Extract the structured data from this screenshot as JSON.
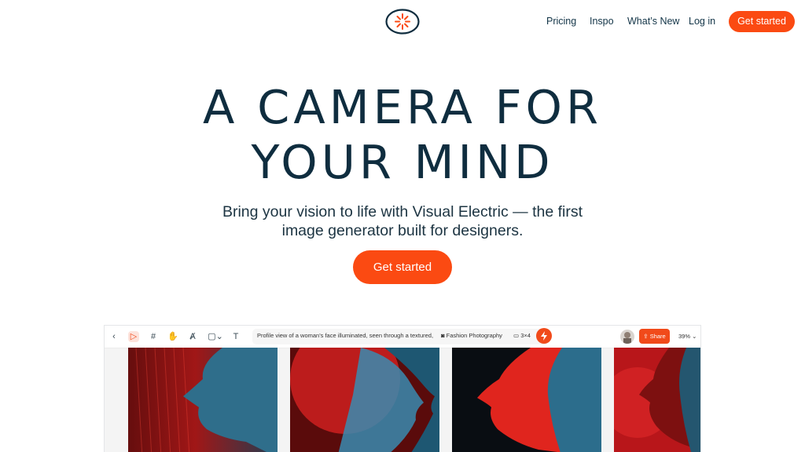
{
  "header": {
    "logo_name": "sunburst-logo",
    "nav": [
      {
        "label": "Pricing"
      },
      {
        "label": "Inspo"
      },
      {
        "label": "What’s New"
      },
      {
        "label": "Log in"
      }
    ],
    "cta_label": "Get started"
  },
  "hero": {
    "title_line1": "A CAMERA FOR",
    "title_line2": "YOUR MIND",
    "subtitle_line1": "Bring your vision to life with Visual Electric — the first",
    "subtitle_line2": "image generator built for designers.",
    "cta_label": "Get started"
  },
  "preview": {
    "toolbar": {
      "tools": [
        "back-icon",
        "select-icon",
        "frame-icon",
        "hand-icon",
        "pen-icon",
        "shape-icon",
        "text-icon"
      ],
      "prompt_text": "Profile view of a woman's face illuminated, seen through a textured, trans",
      "style_label": "Fashion Photography",
      "ratio_label": "3×4",
      "share_label": "Share",
      "zoom_label": "39%"
    }
  },
  "colors": {
    "accent": "#fb4a12",
    "heading": "#0f2d3f",
    "text": "#1c3442"
  }
}
